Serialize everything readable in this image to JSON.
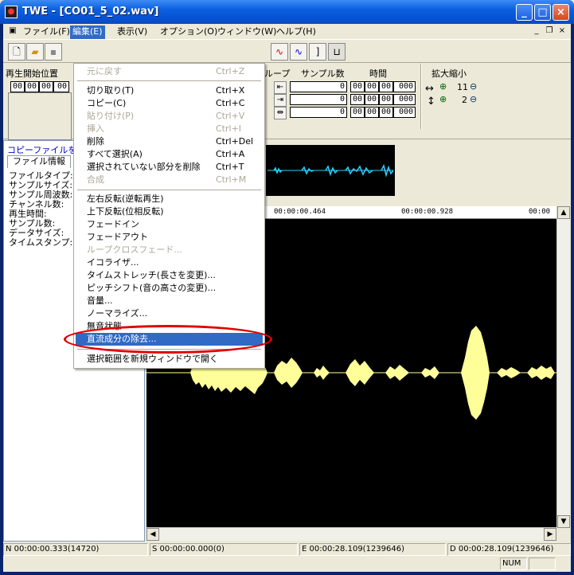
{
  "window": {
    "title": "TWE - [CO01_5_02.wav]"
  },
  "menubar": {
    "items": [
      {
        "label": "ファイル(F)"
      },
      {
        "label": "編集(E)"
      },
      {
        "label": "表示(V)"
      },
      {
        "label": "オプション(O)"
      },
      {
        "label": "ウィンドウ(W)"
      },
      {
        "label": "ヘルプ(H)"
      }
    ]
  },
  "panel": {
    "playback_start_label": "再生開始位置",
    "loop_label": "ループ",
    "sample_count_label": "サンプル数",
    "time_label": "時間",
    "zoom_label": "拡大縮小",
    "start_pos_values": [
      "00",
      "00",
      "00",
      "00"
    ],
    "sample_rows": [
      "0",
      "0",
      "0"
    ],
    "time_rows": [
      [
        "00",
        "00",
        "00",
        "000"
      ],
      [
        "00",
        "00",
        "00",
        "000"
      ],
      [
        "00",
        "00",
        "00",
        "000"
      ]
    ],
    "zoom_h_value": "11",
    "zoom_v_value": "2"
  },
  "leftpane": {
    "copy_file_label": "コピーファイルを編",
    "tab_file_info": "ファイル情報",
    "fields": [
      "ファイルタイプ:",
      "サンプルサイズ:",
      "サンプル周波数:",
      "チャンネル数:",
      "再生時間:",
      "サンプル数:",
      "データサイズ:",
      "タイムスタンプ:"
    ]
  },
  "ruler": {
    "labels": [
      "00:00:00.464",
      "00:00:00.928",
      "00:00"
    ]
  },
  "edit_menu": {
    "items": [
      {
        "label": "元に戻す",
        "shortcut": "Ctrl+Z",
        "disabled": true
      },
      {
        "label": "切り取り(T)",
        "shortcut": "Ctrl+X",
        "disabled": false
      },
      {
        "label": "コピー(C)",
        "shortcut": "Ctrl+C",
        "disabled": false
      },
      {
        "label": "貼り付け(P)",
        "shortcut": "Ctrl+V",
        "disabled": true
      },
      {
        "label": "挿入",
        "shortcut": "Ctrl+I",
        "disabled": true
      },
      {
        "label": "削除",
        "shortcut": "Ctrl+Del",
        "disabled": false
      },
      {
        "label": "すべて選択(A)",
        "shortcut": "Ctrl+A",
        "disabled": false
      },
      {
        "label": "選択されていない部分を削除",
        "shortcut": "Ctrl+T",
        "disabled": false
      },
      {
        "label": "合成",
        "shortcut": "Ctrl+M",
        "disabled": true
      },
      {
        "label": "左右反転(逆転再生)",
        "shortcut": "",
        "disabled": false
      },
      {
        "label": "上下反転(位相反転)",
        "shortcut": "",
        "disabled": false
      },
      {
        "label": "フェードイン",
        "shortcut": "",
        "disabled": false
      },
      {
        "label": "フェードアウト",
        "shortcut": "",
        "disabled": false
      },
      {
        "label": "ループクロスフェード...",
        "shortcut": "",
        "disabled": true
      },
      {
        "label": "イコライザ...",
        "shortcut": "",
        "disabled": false
      },
      {
        "label": "タイムストレッチ(長さを変更)...",
        "shortcut": "",
        "disabled": false
      },
      {
        "label": "ピッチシフト(音の高さの変更)...",
        "shortcut": "",
        "disabled": false
      },
      {
        "label": "音量...",
        "shortcut": "",
        "disabled": false
      },
      {
        "label": "ノーマライズ...",
        "shortcut": "",
        "disabled": false
      },
      {
        "label": "無音状態",
        "shortcut": "",
        "disabled": false
      },
      {
        "label": "直流成分の除去...",
        "shortcut": "",
        "disabled": false
      },
      {
        "label": "選択範囲を新規ウィンドウで開く",
        "shortcut": "",
        "disabled": false
      }
    ]
  },
  "statusbar": {
    "n": "N 00:00:00.333(14720)",
    "s": "S 00:00:00.000(0)",
    "e": "E 00:00:28.109(1239646)",
    "d": "D 00:00:28.109(1239646)",
    "num": "NUM"
  },
  "colors": {
    "accent": "#316ac5",
    "wave": "#ffff99",
    "overview_wave": "#33ccff",
    "ellipse": "#e00000"
  }
}
